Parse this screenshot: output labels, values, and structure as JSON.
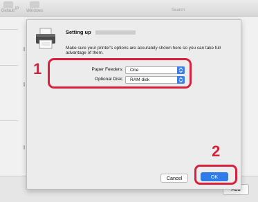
{
  "background_window": {
    "toolbar": {
      "default_label": "Default",
      "ip_label": "IP",
      "windows_label": "Windows",
      "search_label": "Search"
    },
    "add_button": "Add"
  },
  "sheet": {
    "title": "Setting up",
    "description": "Make sure your printer's options are accurately shown here so you can take full advantage of them.",
    "options": [
      {
        "label": "Paper Feeders:",
        "value": "One"
      },
      {
        "label": "Optional Disk:",
        "value": "RAM disk"
      }
    ],
    "cancel_button": "Cancel",
    "ok_button": "OK"
  },
  "annotations": {
    "step_1": "1",
    "step_2": "2",
    "callout_color": "#d8203d"
  },
  "colors": {
    "accent": "#2f7ce9"
  }
}
